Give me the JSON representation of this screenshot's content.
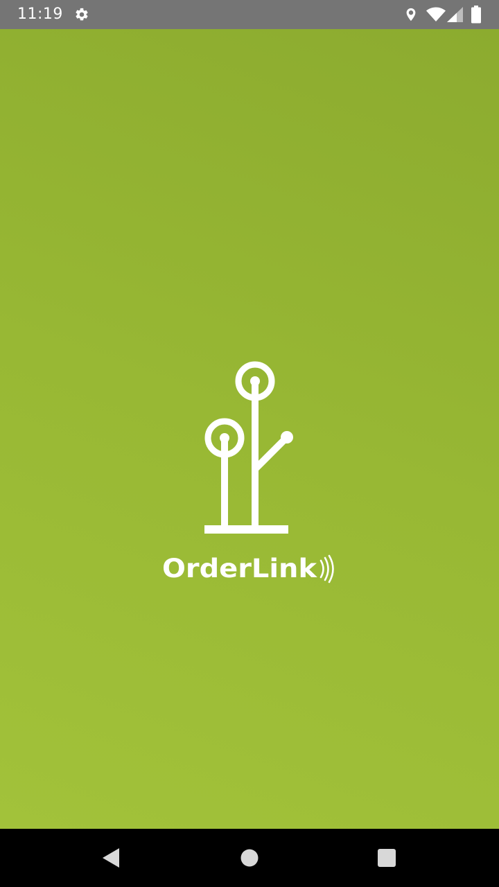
{
  "status_bar": {
    "time": "11:19",
    "icons": [
      "settings-gear-icon",
      "location-pin-icon",
      "wifi-icon",
      "cellular-signal-icon",
      "battery-icon"
    ]
  },
  "splash": {
    "app_name": "OrderLink",
    "brand_colors": {
      "background_top": "#8cab2f",
      "background_bottom": "#a2c23a",
      "logo": "#ffffff"
    }
  },
  "nav_bar": {
    "buttons": [
      "back-icon",
      "home-icon",
      "recents-icon"
    ]
  }
}
